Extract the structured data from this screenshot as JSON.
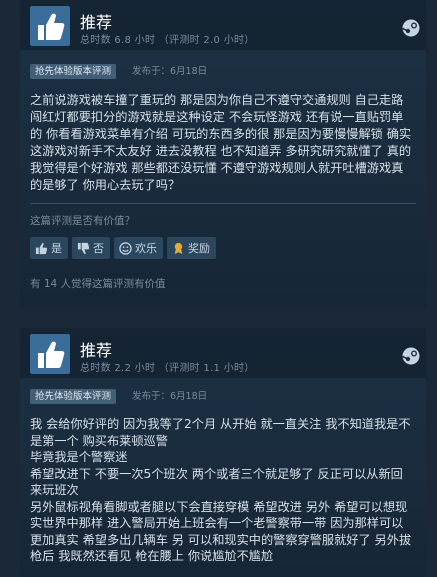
{
  "reviews": [
    {
      "recommendation": "推荐",
      "hours": "总时数 6.8 小时 （评测时 2.0 小时）",
      "badge": "抢先体验版本评测",
      "posted": "发布于：6月18日",
      "body": "之前说游戏被车撞了重玩的 那是因为你自己不遵守交通规则 自己走路闯红灯都要扣分的游戏就是这种设定 不会玩怪游戏 还有说一直贴罚单的 你看看游戏菜单有介绍 可玩的东西多的很 那是因为要慢慢解锁 确实这游戏对新手不太友好 进去没教程 也不知道弄 多研究研究就懂了 真的我觉得是个好游戏 那些都还没玩懂 不遵守游戏规则人就开吐槽游戏真的是够了 你用心去玩了吗？",
      "helpful_question": "这篇评测是否有价值？",
      "votes": {
        "yes": "是",
        "no": "否",
        "funny": "欢乐",
        "award": "奖励"
      },
      "helpful_count": "有 14 人觉得这篇评测有价值"
    },
    {
      "recommendation": "推荐",
      "hours": "总时数 2.2 小时 （评测时 1.1 小时）",
      "badge": "抢先体验版本评测",
      "posted": "发布于：6月18日",
      "body": "我 会给你好评的 因为我等了2个月 从开始 就一直关注 我不知道我是不是第一个 购买布莱顿巡警\n毕竟我是个警察迷\n希望改进下 不要一次5个班次 两个或者三个就足够了 反正可以从新回来玩班次\n另外鼠标视角看脚或者腿以下会直接穿模 希望改进 另外 希望可以想现实世界中那样 进入警局开始上班会有一个老警察带一带 因为那样可以更加真实 希望多出几辆车 另 可以和现实中的警察穿警服就好了 另外拔枪后 我既然还看见 枪在腰上 你说尴尬不尴尬"
    }
  ],
  "icons": {
    "recommend": "thumbs-up-icon",
    "platform": "steam-icon",
    "vote_yes": "thumbs-up-icon",
    "vote_no": "thumbs-down-icon",
    "vote_funny": "smiley-icon",
    "vote_award": "award-icon"
  },
  "colors": {
    "background": "#1b2838",
    "card": "#1d3246",
    "thumb_tile": "#3a6d99",
    "badge_bg": "#435f77",
    "muted_text": "#7a8b9c"
  }
}
